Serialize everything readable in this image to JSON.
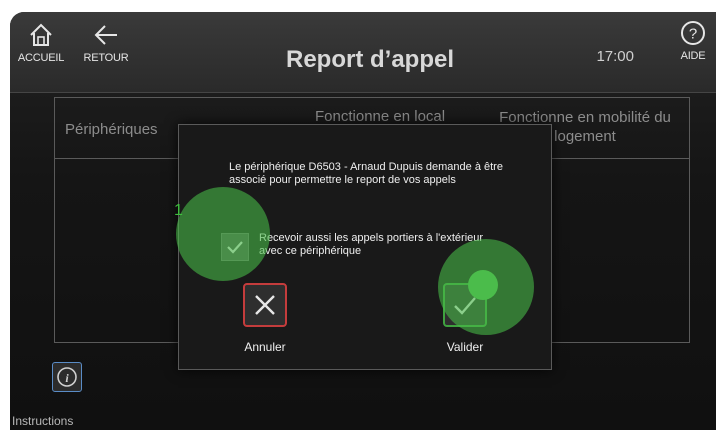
{
  "header": {
    "home_label": "ACCUEIL",
    "back_label": "RETOUR",
    "title": "Report d’appel",
    "time": "17:00",
    "help_label": "AIDE",
    "icons": {
      "home": "home-icon",
      "back": "arrow-left-icon",
      "help": "question-circle-icon"
    }
  },
  "table": {
    "headers": [
      "Périphériques",
      "Fonctionne en local",
      "Fonctionne en mobilité du logement"
    ]
  },
  "dialog": {
    "message": "Le périphérique D6503 - Arnaud Dupuis demande à être associé pour permettre le report de vos appels",
    "checkbox_label": "Recevoir aussi les appels portiers à l'extérieur avec ce périphérique",
    "checkbox_checked": true,
    "cancel_label": "Annuler",
    "ok_label": "Valider"
  },
  "touch_marker_number": "1",
  "footer": {
    "instructions_label": "Instructions",
    "icon": "info-icon"
  },
  "colors": {
    "cancel": "#c43c3c",
    "ok": "#3fa13f",
    "touch": "#48be48",
    "info": "#5a8cc6"
  }
}
